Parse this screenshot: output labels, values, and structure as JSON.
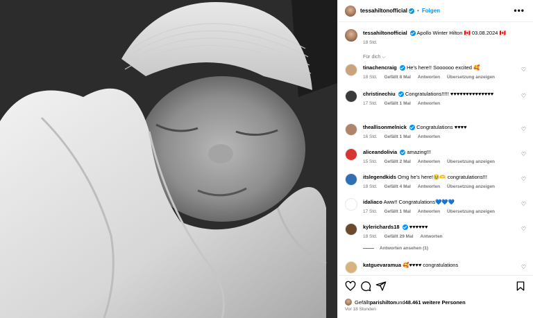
{
  "header": {
    "username": "tessahiltonofficial",
    "separator": "•",
    "follow_label": "Folgen",
    "more_label": "•••"
  },
  "caption": {
    "username": "tessahiltonofficial",
    "text": "Apollo Winter Hilton 🇨🇦 03.08.2024 🇨🇦",
    "time": "18 Std."
  },
  "sort_label": "Für dich ⌵",
  "comments": [
    {
      "user": "tinachencraig",
      "verified": true,
      "text": "He's here!! Soooooo excited 🥰",
      "time": "18 Std.",
      "likes": "Gefällt 8 Mal",
      "reply": "Antworten",
      "translate": "Übersetzung anzeigen",
      "avatar_color": "#c9a37a"
    },
    {
      "user": "christinechiu",
      "verified": true,
      "text": "Congratulations!!!!! ♥♥♥♥♥♥♥♥♥♥♥♥♥♥",
      "time": "17 Std.",
      "likes": "Gefällt 1 Mal",
      "reply": "Antworten",
      "translate": "",
      "avatar_color": "#3a3a3a"
    },
    {
      "user": "theallisonmelnick",
      "verified": true,
      "text": "Congratulations ♥♥♥♥",
      "time": "16 Std.",
      "likes": "Gefällt 1 Mal",
      "reply": "Antworten",
      "translate": "",
      "avatar_color": "#b08468"
    },
    {
      "user": "aliceandolivia",
      "verified": true,
      "text": "amazing!!!",
      "time": "15 Std.",
      "likes": "Gefällt 2 Mal",
      "reply": "Antworten",
      "translate": "Übersetzung anzeigen",
      "avatar_color": "#d6362f"
    },
    {
      "user": "itslegendkids",
      "verified": false,
      "text": "Omg he's here!🥹🫶 congratulations!!!",
      "time": "18 Std.",
      "likes": "Gefällt 4 Mal",
      "reply": "Antworten",
      "translate": "Übersetzung anzeigen",
      "avatar_color": "#2f6fb4"
    },
    {
      "user": "idaliaco",
      "verified": false,
      "text": "Aww!! Congratulations💙💙💙",
      "time": "17 Std.",
      "likes": "Gefällt 1 Mal",
      "reply": "Antworten",
      "translate": "Übersetzung anzeigen",
      "avatar_color": "#ffffff"
    },
    {
      "user": "kylerichards18",
      "verified": true,
      "text": "♥♥♥♥♥♥",
      "time": "18 Std.",
      "likes": "Gefällt 29 Mal",
      "reply": "Antworten",
      "translate": "",
      "avatar_color": "#6b4a2e"
    },
    {
      "user": "katguevaramua",
      "verified": false,
      "text": "🥰♥♥♥♥ congratulations",
      "time": "",
      "likes": "",
      "reply": "",
      "translate": "",
      "avatar_color": "#d9b37c"
    }
  ],
  "view_replies": "Antworten ansehen (1)",
  "actions": {
    "like_icon": "heart-icon",
    "comment_icon": "comment-icon",
    "share_icon": "share-icon",
    "save_icon": "bookmark-icon"
  },
  "likes_line": {
    "prefix": "Gefällt ",
    "user": "parishilton",
    "middle": " und ",
    "count": "48.461 weitere Personen"
  },
  "posted_ago": "Vor 18 Stunden",
  "colors": {
    "accent": "#0095f6",
    "muted": "#737373",
    "border": "#efefef"
  }
}
